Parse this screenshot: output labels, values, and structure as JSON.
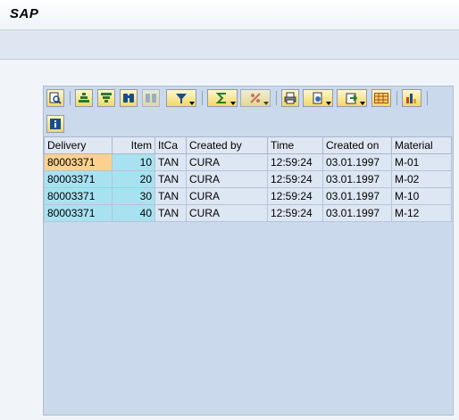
{
  "window": {
    "title": "SAP"
  },
  "toolbar": {
    "buttons": [
      "details-icon",
      "sort-ascending-icon",
      "filter-icon",
      "find-icon",
      "find-next-icon",
      "set-filter-icon",
      "total-icon",
      "subtotals-icon",
      "print-preview-icon",
      "export-icon",
      "send-icon",
      "layout-icon",
      "chart-icon",
      "info-icon"
    ]
  },
  "table": {
    "columns": [
      "Delivery",
      "Item",
      "ItCa",
      "Created by",
      "Time",
      "Created on",
      "Material"
    ],
    "rows": [
      [
        "80003371",
        "10",
        "TAN",
        "CURA",
        "12:59:24",
        "03.01.1997",
        "M-01"
      ],
      [
        "80003371",
        "20",
        "TAN",
        "CURA",
        "12:59:24",
        "03.01.1997",
        "M-02"
      ],
      [
        "80003371",
        "30",
        "TAN",
        "CURA",
        "12:59:24",
        "03.01.1997",
        "M-10"
      ],
      [
        "80003371",
        "40",
        "TAN",
        "CURA",
        "12:59:24",
        "03.01.1997",
        "M-12"
      ]
    ]
  },
  "colors": {
    "selected_cell": "#fcd18e",
    "key_column": "#a8e2f1",
    "grid_background": "#cbd9ec"
  }
}
